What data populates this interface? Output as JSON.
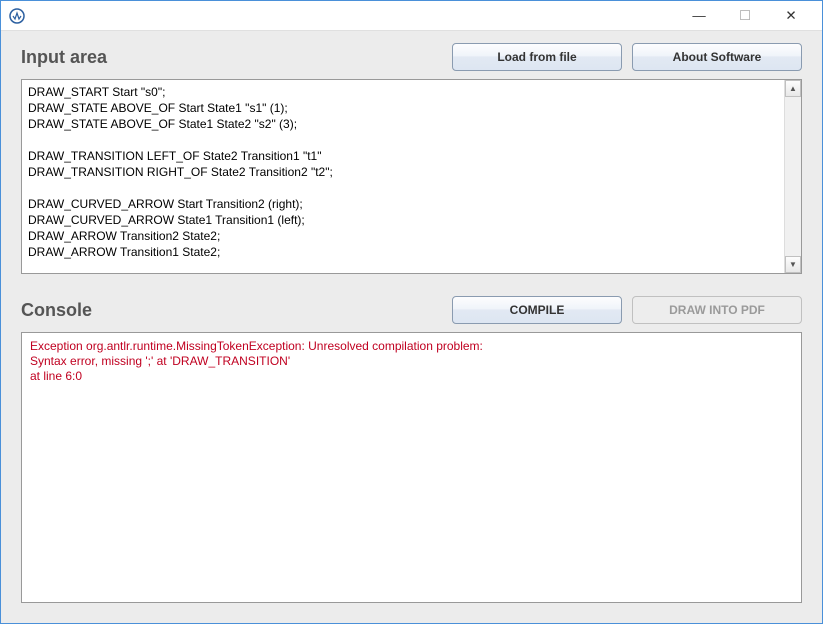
{
  "titlebar": {
    "minimize_glyph": "—",
    "maximize_glyph": "☐",
    "close_glyph": "✕"
  },
  "input_section": {
    "title": "Input area",
    "load_button": "Load from file",
    "about_button": "About Software",
    "code": "DRAW_START Start \"s0\";\nDRAW_STATE ABOVE_OF Start State1 \"s1\" (1);\nDRAW_STATE ABOVE_OF State1 State2 \"s2\" (3);\n\nDRAW_TRANSITION LEFT_OF State2 Transition1 \"t1\"\nDRAW_TRANSITION RIGHT_OF State2 Transition2 \"t2\";\n\nDRAW_CURVED_ARROW Start Transition2 (right);\nDRAW_CURVED_ARROW State1 Transition1 (left);\nDRAW_ARROW Transition2 State2;\nDRAW_ARROW Transition1 State2;"
  },
  "console_section": {
    "title": "Console",
    "compile_button": "COMPILE",
    "draw_pdf_button": "DRAW INTO PDF",
    "output": "Exception org.antlr.runtime.MissingTokenException: Unresolved compilation problem:\nSyntax error, missing ';' at 'DRAW_TRANSITION'\nat line 6:0"
  },
  "scrollbar": {
    "up_glyph": "▲",
    "down_glyph": "▼"
  }
}
